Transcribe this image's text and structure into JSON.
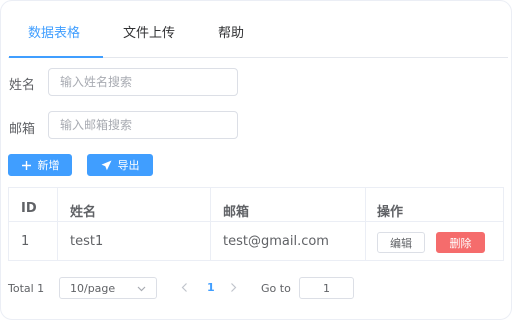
{
  "tabs": [
    {
      "label": "数据表格",
      "active": true
    },
    {
      "label": "文件上传",
      "active": false
    },
    {
      "label": "帮助",
      "active": false
    }
  ],
  "filters": {
    "name": {
      "label": "姓名",
      "placeholder": "输入姓名搜索",
      "value": ""
    },
    "email": {
      "label": "邮箱",
      "placeholder": "输入邮箱搜索",
      "value": ""
    }
  },
  "toolbar": {
    "add_label": "新增",
    "add_icon": "plus-icon",
    "export_label": "导出",
    "export_icon": "send-icon"
  },
  "table": {
    "columns": [
      "ID",
      "姓名",
      "邮箱",
      "操作"
    ],
    "rows": [
      {
        "id": "1",
        "name": "test1",
        "email": "test@gmail.com",
        "edit_label": "编辑",
        "delete_label": "删除"
      }
    ]
  },
  "pagination": {
    "total_text": "Total 1",
    "page_size": "10/page",
    "current_page": "1",
    "goto_label": "Go to",
    "goto_value": "1"
  },
  "colors": {
    "primary": "#409eff",
    "danger": "#f56c6c",
    "border": "#dcdfe6"
  }
}
